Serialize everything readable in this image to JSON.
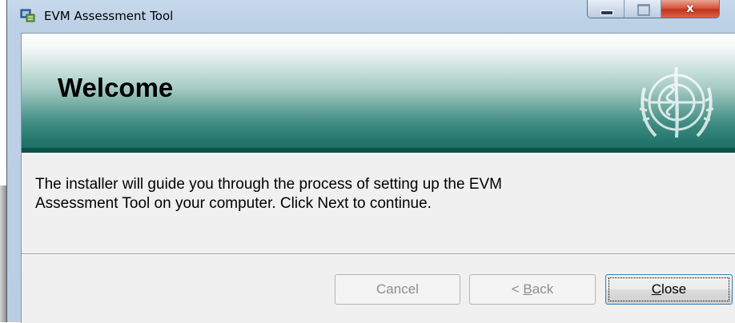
{
  "window": {
    "title": "EVM Assessment Tool"
  },
  "caption_buttons": {
    "close_glyph": "x"
  },
  "banner": {
    "title": "Welcome",
    "logo_icon": "un-emblem-icon"
  },
  "body": {
    "message_line1": "The installer will guide you through the process of setting up the EVM",
    "message_line2": "Assessment Tool on your computer. Click Next to continue."
  },
  "buttons": {
    "cancel": "Cancel",
    "back_prefix": "< ",
    "back_mnemonic": "B",
    "back_rest": "ack",
    "close_mnemonic": "C",
    "close_rest": "lose"
  },
  "colors": {
    "banner_dark": "#13695f",
    "focus_border": "#3c7fb1",
    "close_red": "#c4321d"
  }
}
